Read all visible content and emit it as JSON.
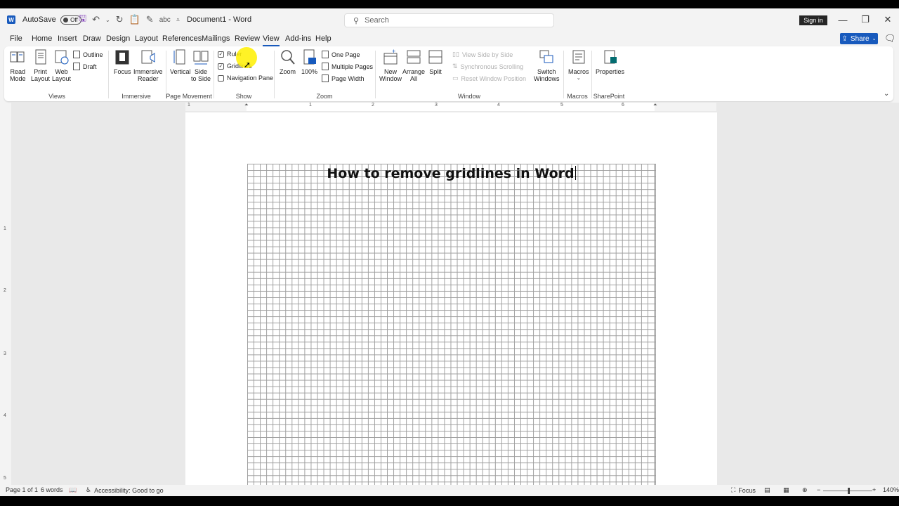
{
  "titlebar": {
    "app_icon": "W",
    "autosave_label": "AutoSave",
    "autosave_state": "Off",
    "document_title": "Document1  -  Word",
    "search_placeholder": "Search",
    "signin_label": "Sign in"
  },
  "menu": {
    "tabs": [
      "File",
      "Home",
      "Insert",
      "Draw",
      "Design",
      "Layout",
      "References",
      "Mailings",
      "Review",
      "View",
      "Add-ins",
      "Help"
    ],
    "active_tab": "View",
    "share_label": "Share"
  },
  "ribbon": {
    "views": {
      "read_mode": [
        "Read",
        "Mode"
      ],
      "print_layout": [
        "Print",
        "Layout"
      ],
      "web_layout": [
        "Web",
        "Layout"
      ],
      "outline": "Outline",
      "draft": "Draft",
      "group": "Views"
    },
    "immersive": {
      "focus": "Focus",
      "immersive_reader": [
        "Immersive",
        "Reader"
      ],
      "group": "Immersive"
    },
    "page_movement": {
      "vertical": "Vertical",
      "side_to_side": [
        "Side",
        "to Side"
      ],
      "group": "Page Movement"
    },
    "show": {
      "ruler": "Ruler",
      "gridlines": "Gridlines",
      "navigation_pane": "Navigation Pane",
      "ruler_checked": true,
      "gridlines_checked": true,
      "navigation_checked": false,
      "group": "Show"
    },
    "zoom": {
      "zoom": "Zoom",
      "hundred": "100%",
      "one_page": "One Page",
      "multiple_pages": "Multiple Pages",
      "page_width": "Page Width",
      "group": "Zoom"
    },
    "window": {
      "new_window": [
        "New",
        "Window"
      ],
      "arrange_all": [
        "Arrange",
        "All"
      ],
      "split": "Split",
      "view_side_by_side": "View Side by Side",
      "sync_scrolling": "Synchronous Scrolling",
      "reset_window": "Reset Window Position",
      "switch_windows": [
        "Switch",
        "Windows"
      ],
      "group": "Window"
    },
    "macros": {
      "macros": "Macros",
      "group": "Macros"
    },
    "sharepoint": {
      "properties": "Properties",
      "group": "SharePoint"
    }
  },
  "ruler": {
    "h_numbers": [
      "1",
      "1",
      "2",
      "3",
      "4",
      "5",
      "6"
    ],
    "v_numbers": [
      "1",
      "2",
      "3",
      "4",
      "5"
    ]
  },
  "document": {
    "heading": "How to remove gridlines in Word"
  },
  "status": {
    "page": "Page 1 of 1",
    "words": "6 words",
    "accessibility": "Accessibility: Good to go",
    "focus": "Focus",
    "zoom_level": "140%"
  },
  "colors": {
    "accent": "#185abd",
    "gridline": "#9e9e9e",
    "highlight": "#fff000"
  }
}
